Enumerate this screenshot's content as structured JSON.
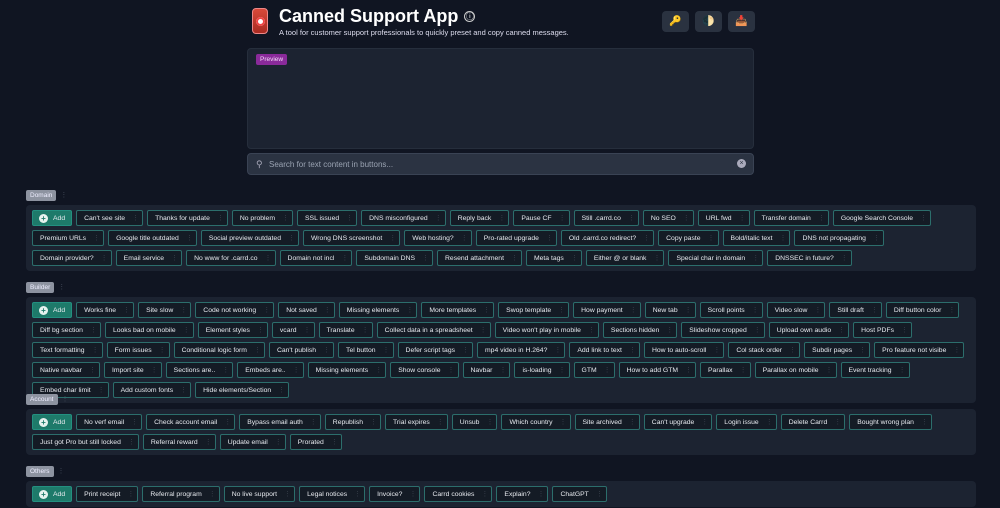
{
  "header": {
    "title": "Canned Support App",
    "subtitle": "A tool for customer support professionals to quickly preset and copy canned messages.",
    "info_icon": "ⓘ",
    "buttons": [
      {
        "icon": "key-icon",
        "glyph": "🔑"
      },
      {
        "icon": "theme-toggle-icon",
        "glyph": "🌓"
      },
      {
        "icon": "inbox-icon",
        "glyph": "📥"
      }
    ]
  },
  "preview": {
    "badge": "Preview"
  },
  "search": {
    "placeholder": "Search for text content in buttons...",
    "value": ""
  },
  "add_label": "Add",
  "sections": [
    {
      "label": "Domain",
      "items": [
        "Can't see site",
        "Thanks for update",
        "No problem",
        "SSL issued",
        "DNS misconfigured",
        "Reply back",
        "Pause CF",
        "Still .carrd.co",
        "No SEO",
        "URL fwd",
        "Transfer domain",
        "Google Search Console",
        "Premium URLs",
        "Google title outdated",
        "Social preview outdated",
        "Wrong DNS screenshot",
        "Web hosting?",
        "Pro-rated upgrade",
        "Old .carrd.co redirect?",
        "Copy paste",
        "Bold/italic text",
        "DNS not propagating",
        "Domain provider?",
        "Email service",
        "No www for .carrd.co",
        "Domain not incl",
        "Subdomain DNS",
        "Resend attachment",
        "Meta tags",
        "Either @ or blank",
        "Special char in domain",
        "DNSSEC in future?"
      ]
    },
    {
      "label": "Builder",
      "items": [
        "Works fine",
        "Site slow",
        "Code not working",
        "Not saved",
        "Missing elements",
        "More templates",
        "Swop template",
        "How payment",
        "New tab",
        "Scroll points",
        "Video slow",
        "Still draft",
        "Diff button color",
        "Diff bg section",
        "Looks bad on mobile",
        "Element styles",
        "vcard",
        "Translate",
        "Collect data in a spreadsheet",
        "Video won't play in mobile",
        "Sections hidden",
        "Slideshow cropped",
        "Upload own audio",
        "Host PDFs",
        "Text formatting",
        "Form issues",
        "Conditional logic form",
        "Can't publish",
        "Tel button",
        "Defer script tags",
        "mp4 video in H.264?",
        "Add link to text",
        "How to auto-scroll",
        "Col stack order",
        "Subdir pages",
        "Pro feature not visibe",
        "Native navbar",
        "Import site",
        "Sections are..",
        "Embeds are..",
        "Missing elements",
        "Show console",
        "Navbar",
        "is-loading",
        "GTM",
        "How to add GTM",
        "Parallax",
        "Parallax on mobile",
        "Event tracking",
        "Embed char limit",
        "Add custom fonts",
        "Hide elements/Section"
      ]
    },
    {
      "label": "Account",
      "items": [
        "No verf email",
        "Check account email",
        "Bypass email auth",
        "Republish",
        "Trial expires",
        "Unsub",
        "Which country",
        "Site archived",
        "Can't upgrade",
        "Login issue",
        "Delete Carrd",
        "Bought wrong plan",
        "Just got Pro but still locked",
        "Referral reward",
        "Update email",
        "Prorated"
      ]
    },
    {
      "label": "Others",
      "items": [
        "Print receipt",
        "Referral program",
        "No live support",
        "Legal notices",
        "Invoice?",
        "Carrd cookies",
        "Explain?",
        "ChatGPT"
      ]
    }
  ]
}
